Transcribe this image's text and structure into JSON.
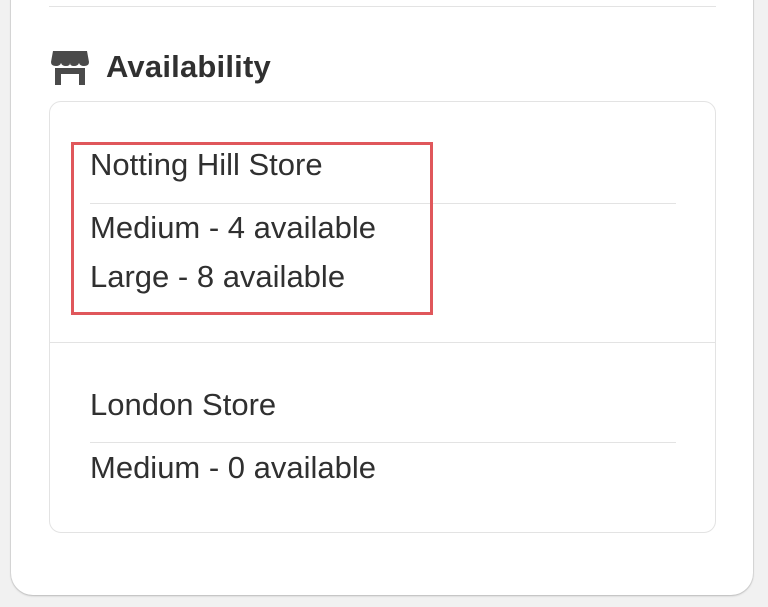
{
  "section": {
    "title": "Availability",
    "icon": "store-icon"
  },
  "stores": [
    {
      "name": "Notting Hill Store",
      "stock": [
        "Medium - 4 available",
        "Large - 8 available"
      ]
    },
    {
      "name": "London Store",
      "stock": [
        "Medium - 0 available"
      ]
    }
  ],
  "colors": {
    "highlight": "#e0575b",
    "text": "#303030",
    "divider": "#e3e3e3"
  }
}
